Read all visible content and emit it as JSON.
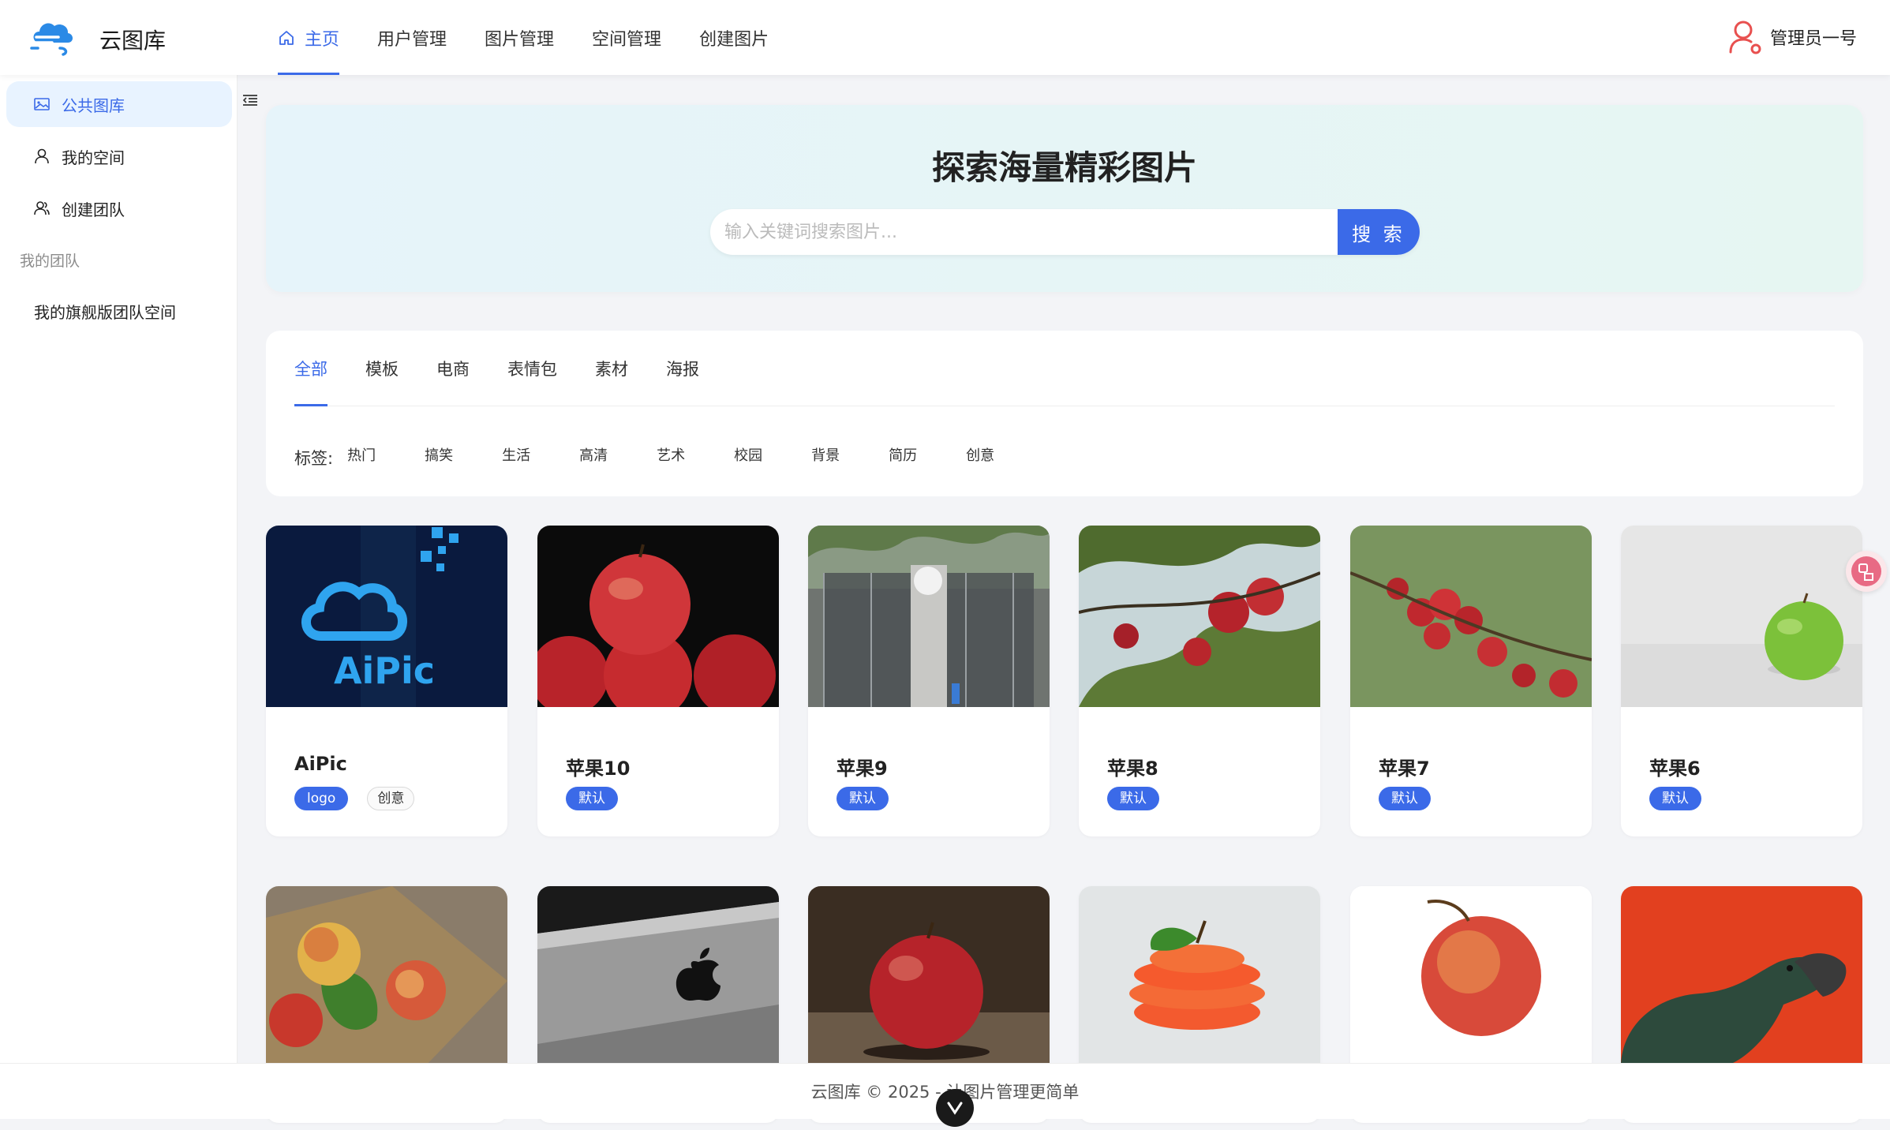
{
  "header": {
    "app_title": "云图库",
    "nav": [
      {
        "label": "主页",
        "active": true
      },
      {
        "label": "用户管理"
      },
      {
        "label": "图片管理"
      },
      {
        "label": "空间管理"
      },
      {
        "label": "创建图片"
      }
    ],
    "user_name": "管理员一号"
  },
  "sidebar": {
    "items": [
      {
        "label": "公共图库",
        "icon": "picture-icon",
        "active": true
      },
      {
        "label": "我的空间",
        "icon": "user-icon"
      },
      {
        "label": "创建团队",
        "icon": "team-icon"
      }
    ],
    "group_label": "我的团队",
    "team_items": [
      {
        "label": "我的旗舰版团队空间"
      }
    ]
  },
  "hero": {
    "title": "探索海量精彩图片",
    "search_placeholder": "输入关键词搜索图片...",
    "search_button": "搜 索"
  },
  "categories": [
    "全部",
    "模板",
    "电商",
    "表情包",
    "素材",
    "海报"
  ],
  "active_category": "全部",
  "tags": {
    "label": "标签:",
    "items": [
      "热门",
      "搞笑",
      "生活",
      "高清",
      "艺术",
      "校园",
      "背景",
      "简历",
      "创意"
    ]
  },
  "pictures": [
    {
      "title": "AiPic",
      "tags": [
        {
          "label": "logo",
          "style": "primary"
        },
        {
          "label": "创意",
          "style": "outline"
        }
      ],
      "image": "aipic-logo",
      "logo_text": "AiPic"
    },
    {
      "title": "苹果10",
      "tags": [
        {
          "label": "默认",
          "style": "primary"
        }
      ],
      "image": "red-apples-dark"
    },
    {
      "title": "苹果9",
      "tags": [
        {
          "label": "默认",
          "style": "primary"
        }
      ],
      "image": "apple-store"
    },
    {
      "title": "苹果8",
      "tags": [
        {
          "label": "默认",
          "style": "primary"
        }
      ],
      "image": "apples-on-tree"
    },
    {
      "title": "苹果7",
      "tags": [
        {
          "label": "默认",
          "style": "primary"
        }
      ],
      "image": "apple-tree-cluster"
    },
    {
      "title": "苹果6",
      "tags": [
        {
          "label": "默认",
          "style": "primary"
        }
      ],
      "image": "green-apple"
    },
    {
      "image": "apples-burlap"
    },
    {
      "image": "macbook-logo"
    },
    {
      "image": "red-apple-bokeh"
    },
    {
      "image": "sliced-apple"
    },
    {
      "image": "red-apple-white"
    },
    {
      "image": "dinosaur-toy"
    }
  ],
  "footer": {
    "text": "云图库 © 2025 - 让图片管理更简单"
  },
  "colors": {
    "primary": "#3b6ae8",
    "sidebar_active_bg": "#e8f3ff",
    "page_bg": "#f3f4f7"
  }
}
